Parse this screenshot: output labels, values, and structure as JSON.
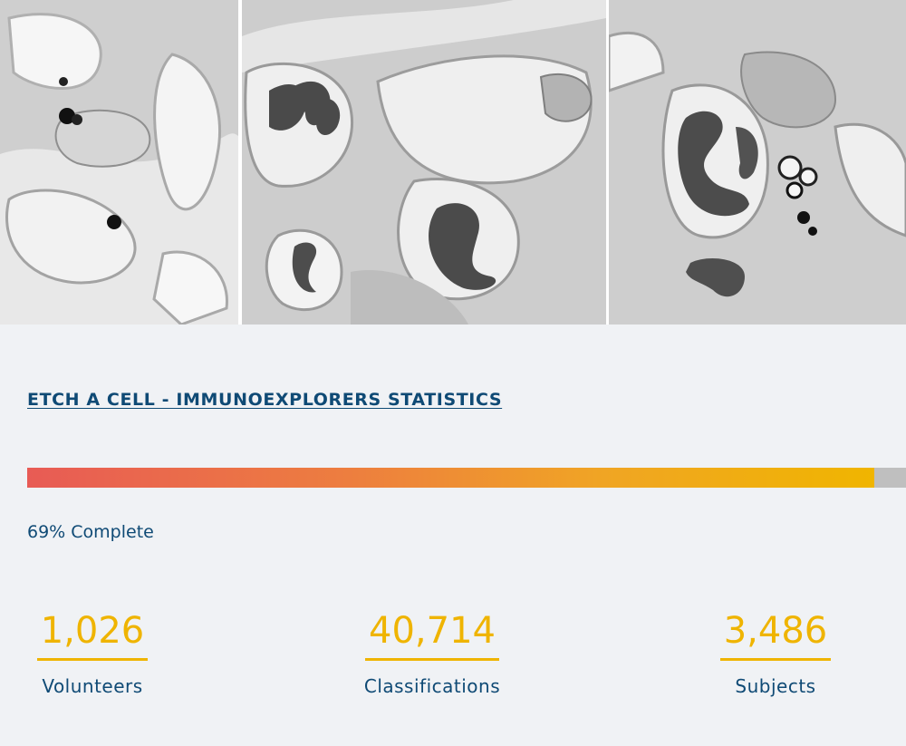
{
  "header_images": [
    {
      "alt": "electron-micrograph-1"
    },
    {
      "alt": "electron-micrograph-2"
    },
    {
      "alt": "electron-micrograph-3"
    }
  ],
  "stats": {
    "title": "ETCH A CELL - IMMUNOEXPLORERS STATISTICS",
    "progress_percent": 69,
    "progress_label": "69% Complete",
    "items": [
      {
        "value": "1,026",
        "label": "Volunteers"
      },
      {
        "value": "40,714",
        "label": "Classifications"
      },
      {
        "value": "3,486",
        "label": "Subjects"
      }
    ]
  },
  "colors": {
    "primary_text": "#0f4a75",
    "accent": "#efb400",
    "progress_start": "#e85b55",
    "progress_end": "#f0b500",
    "track": "#bfbfbf",
    "background": "#f0f2f5"
  }
}
